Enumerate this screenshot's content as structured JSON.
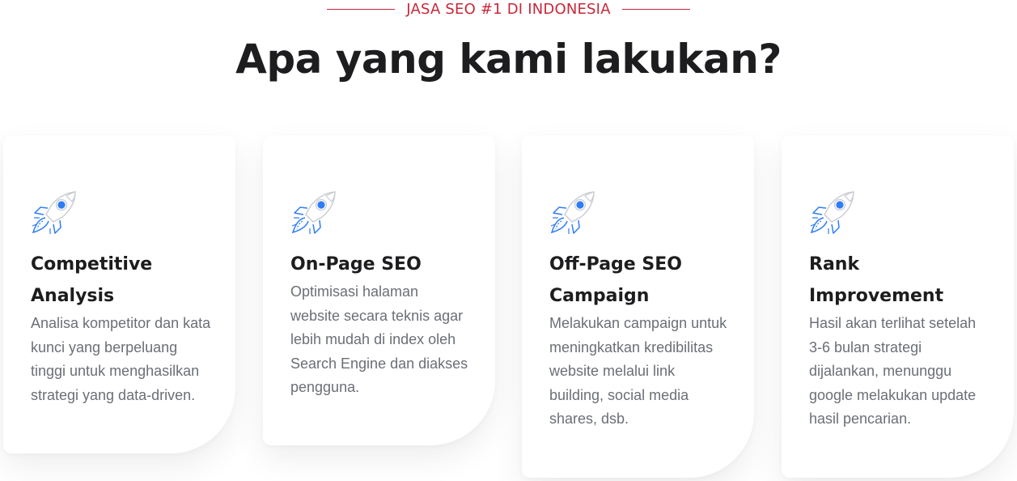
{
  "section": {
    "eyebrow": "JASA SEO #1 DI INDONESIA",
    "heading": "Apa yang kami lakukan?"
  },
  "colors": {
    "accent": "#c8283a",
    "heading": "#1d1d1f",
    "body_text": "#6b6f76",
    "icon_blue": "#2f7df6"
  },
  "cards": [
    {
      "icon": "rocket-icon",
      "title_line1": "Competitive",
      "title_line2": "Analysis",
      "description": "Analisa kompetitor dan kata kunci yang berpeluang tinggi untuk menghasilkan strategi yang data-driven."
    },
    {
      "icon": "rocket-icon",
      "title_line1": "On-Page SEO",
      "title_line2": "",
      "description": "Optimisasi halaman website secara teknis agar lebih mudah di index oleh Search Engine dan diakses pengguna."
    },
    {
      "icon": "rocket-icon",
      "title_line1": "Off-Page SEO",
      "title_line2": "Campaign",
      "description": "Melakukan campaign untuk meningkatkan kredibilitas website melalui link building, social media shares, dsb."
    },
    {
      "icon": "rocket-icon",
      "title_line1": "Rank",
      "title_line2": "Improvement",
      "description": "Hasil akan terlihat setelah 3-6 bulan strategi dijalankan, menunggu google melakukan update hasil pencarian."
    }
  ]
}
